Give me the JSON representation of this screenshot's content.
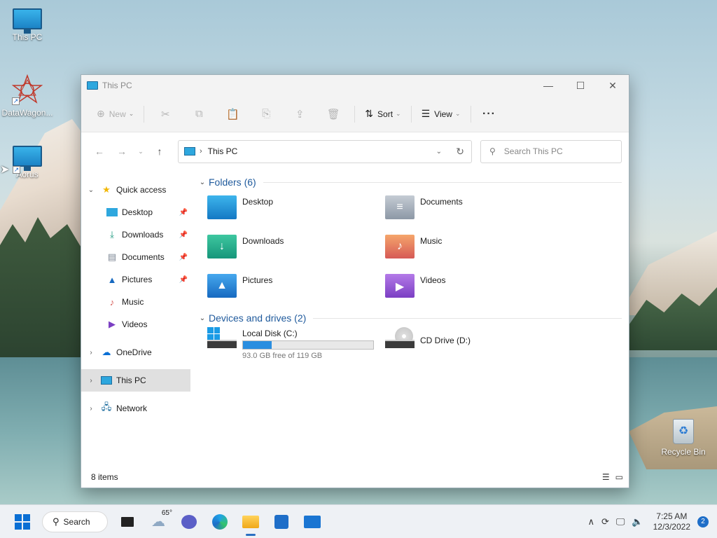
{
  "desktop": {
    "icons": [
      {
        "label": "This PC"
      },
      {
        "label": "DataWagon..."
      },
      {
        "label": "Aorus"
      }
    ],
    "recycle_bin": "Recycle Bin"
  },
  "window": {
    "title": "This PC",
    "controls": {
      "minimize": "—",
      "maximize": "☐",
      "close": "✕"
    },
    "commandbar": {
      "new_label": "New",
      "sort_label": "Sort",
      "view_label": "View",
      "more_label": "···"
    },
    "address": {
      "crumb": "This PC",
      "search_placeholder": "Search This PC"
    },
    "sidebar": {
      "quick_access": "Quick access",
      "quick_items": [
        {
          "label": "Desktop",
          "icon": "desktop-icon",
          "pinned": true
        },
        {
          "label": "Downloads",
          "icon": "downloads-icon",
          "pinned": true
        },
        {
          "label": "Documents",
          "icon": "documents-icon",
          "pinned": true
        },
        {
          "label": "Pictures",
          "icon": "pictures-icon",
          "pinned": true
        },
        {
          "label": "Music",
          "icon": "music-icon",
          "pinned": false
        },
        {
          "label": "Videos",
          "icon": "videos-icon",
          "pinned": false
        }
      ],
      "onedrive": "OneDrive",
      "this_pc": "This PC",
      "network": "Network"
    },
    "folders_group": "Folders (6)",
    "folders": [
      {
        "label": "Desktop"
      },
      {
        "label": "Documents"
      },
      {
        "label": "Downloads"
      },
      {
        "label": "Music"
      },
      {
        "label": "Pictures"
      },
      {
        "label": "Videos"
      }
    ],
    "drives_group": "Devices and drives (2)",
    "drives": [
      {
        "label": "Local Disk (C:)",
        "free_text": "93.0 GB free of 119 GB",
        "used_fraction": 0.218
      },
      {
        "label": "CD Drive (D:)"
      }
    ],
    "status": "8 items"
  },
  "taskbar": {
    "search_label": "Search",
    "weather_temp": "65°",
    "time": "7:25 AM",
    "date": "12/3/2022",
    "notification_count": "2"
  },
  "colors": {
    "accent": "#2a8ee0",
    "group_heading": "#1f5a9c"
  }
}
